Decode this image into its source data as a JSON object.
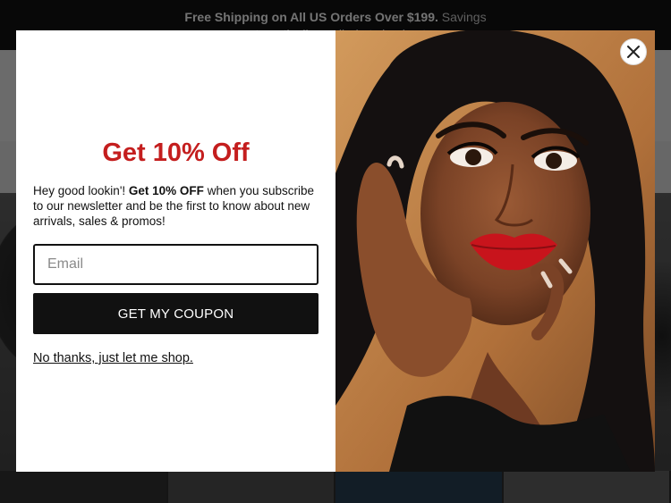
{
  "announcement": {
    "bold": "Free Shipping on All US Orders Over $199.",
    "rest": " Savings automatically applied at checkout."
  },
  "popup": {
    "title": "Get 10% Off",
    "desc_prefix": "Hey good lookin'! ",
    "desc_bold": "Get 10% OFF",
    "desc_suffix": " when you subscribe to our newsletter and be the first to know about new arrivals, sales & promos!",
    "email_placeholder": "Email",
    "email_value": "",
    "coupon_button": "GET MY COUPON",
    "decline_link": "No thanks, just let me shop.",
    "close_icon": "close-icon"
  },
  "colors": {
    "title": "#c41e1e",
    "button_bg": "#111111",
    "announcement_bg": "#111111"
  }
}
